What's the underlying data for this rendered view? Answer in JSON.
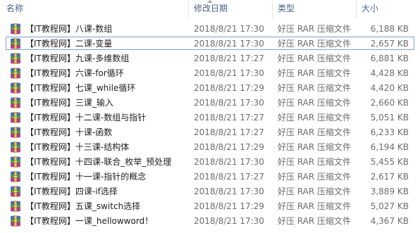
{
  "columns": {
    "name": "名称",
    "modified": "修改日期",
    "type": "类型",
    "size": "大小"
  },
  "icon": "winrar-archive-icon",
  "colors": {
    "header_text": "#4d6185",
    "selection_border": "#7da2ce"
  },
  "files": [
    {
      "name": "【IT教程网】八课-数组",
      "modified": "2018/8/21 17:30",
      "type": "好压 RAR 压缩文件",
      "size": "6,188 KB"
    },
    {
      "name": "【IT教程网】二课-变量",
      "modified": "2018/8/21 17:30",
      "type": "好压 RAR 压缩文件",
      "size": "2,657 KB"
    },
    {
      "name": "【IT教程网】九课-多维数组",
      "modified": "2018/8/21 17:27",
      "type": "好压 RAR 压缩文件",
      "size": "6,881 KB"
    },
    {
      "name": "【IT教程网】六课-for循环",
      "modified": "2018/8/21 17:30",
      "type": "好压 RAR 压缩文件",
      "size": "4,428 KB"
    },
    {
      "name": "【IT教程网】七课_while循环",
      "modified": "2018/8/21 17:29",
      "type": "好压 RAR 压缩文件",
      "size": "4,420 KB"
    },
    {
      "name": "【IT教程网】三课_输入",
      "modified": "2018/8/21 17:30",
      "type": "好压 RAR 压缩文件",
      "size": "2,660 KB"
    },
    {
      "name": "【IT教程网】十二课-数组与指针",
      "modified": "2018/8/21 17:27",
      "type": "好压 RAR 压缩文件",
      "size": "5,051 KB"
    },
    {
      "name": "【IT教程网】十课-函数",
      "modified": "2018/8/21 17:27",
      "type": "好压 RAR 压缩文件",
      "size": "6,233 KB"
    },
    {
      "name": "【IT教程网】十三课-结构体",
      "modified": "2018/8/21 17:29",
      "type": "好压 RAR 压缩文件",
      "size": "6,194 KB"
    },
    {
      "name": "【IT教程网】十四课-联合_枚举_预处理",
      "modified": "2018/8/21 17:30",
      "type": "好压 RAR 压缩文件",
      "size": "5,455 KB"
    },
    {
      "name": "【IT教程网】十一课-指针的概念",
      "modified": "2018/8/21 17:27",
      "type": "好压 RAR 压缩文件",
      "size": "2,617 KB"
    },
    {
      "name": "【IT教程网】四课-if选择",
      "modified": "2018/8/21 17:30",
      "type": "好压 RAR 压缩文件",
      "size": "3,889 KB"
    },
    {
      "name": "【IT教程网】五课_switch选择",
      "modified": "2018/8/21 17:29",
      "type": "好压 RAR 压缩文件",
      "size": "5,027 KB"
    },
    {
      "name": "【IT教程网】一课_hellowword！",
      "modified": "2018/8/21 17:30",
      "type": "好压 RAR 压缩文件",
      "size": "4,367 KB"
    }
  ]
}
